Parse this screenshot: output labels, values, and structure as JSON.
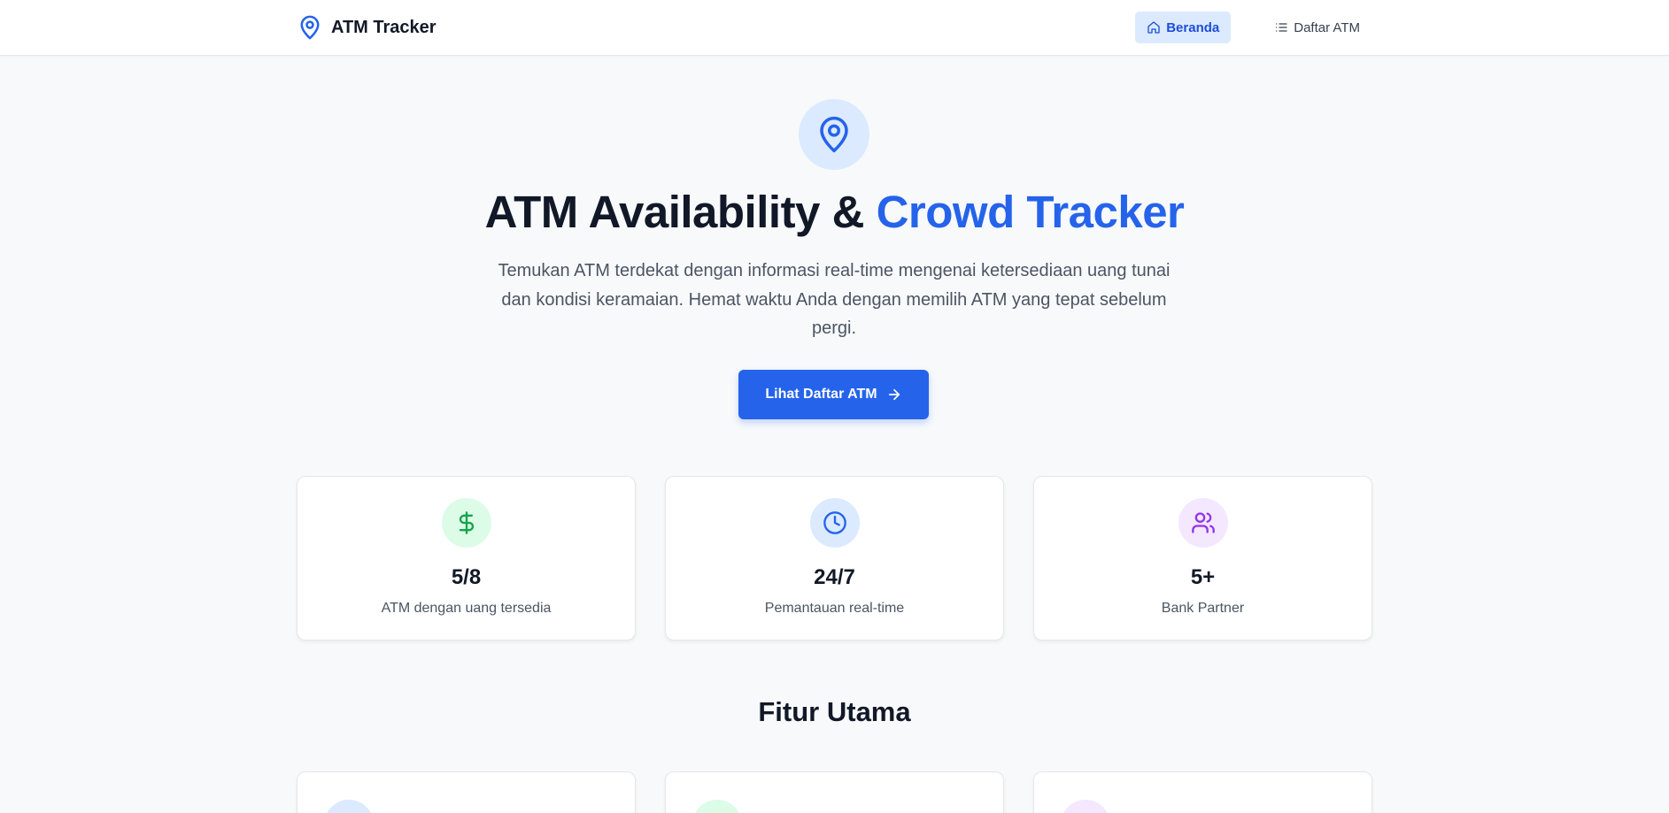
{
  "navbar": {
    "brand": "ATM Tracker",
    "links": [
      {
        "label": "Beranda",
        "icon": "home-icon",
        "active": true
      },
      {
        "label": "Daftar ATM",
        "icon": "list-icon",
        "active": false
      }
    ]
  },
  "hero": {
    "icon": "map-pin-icon",
    "title_main": "ATM Availability & ",
    "title_accent": "Crowd Tracker",
    "description": "Temukan ATM terdekat dengan informasi real-time mengenai ketersediaan uang tunai dan kondisi keramaian. Hemat waktu Anda dengan memilih ATM yang tepat sebelum pergi.",
    "cta_label": "Lihat Daftar ATM"
  },
  "stats": [
    {
      "icon": "dollar-icon",
      "value": "5/8",
      "label": "ATM dengan uang tersedia",
      "color": "#16a34a",
      "bg": "#dcfce7"
    },
    {
      "icon": "clock-icon",
      "value": "24/7",
      "label": "Pemantauan real-time",
      "color": "#2563eb",
      "bg": "#dbeafe"
    },
    {
      "icon": "users-icon",
      "value": "5+",
      "label": "Bank Partner",
      "color": "#9333ea",
      "bg": "#f3e8ff"
    }
  ],
  "features": {
    "title": "Fitur Utama",
    "cards": [
      {
        "color": "#dbeafe"
      },
      {
        "color": "#dcfce7"
      },
      {
        "color": "#f3e8ff"
      }
    ]
  },
  "colors": {
    "accent": "#2563eb",
    "background": "#f8f9fb"
  }
}
